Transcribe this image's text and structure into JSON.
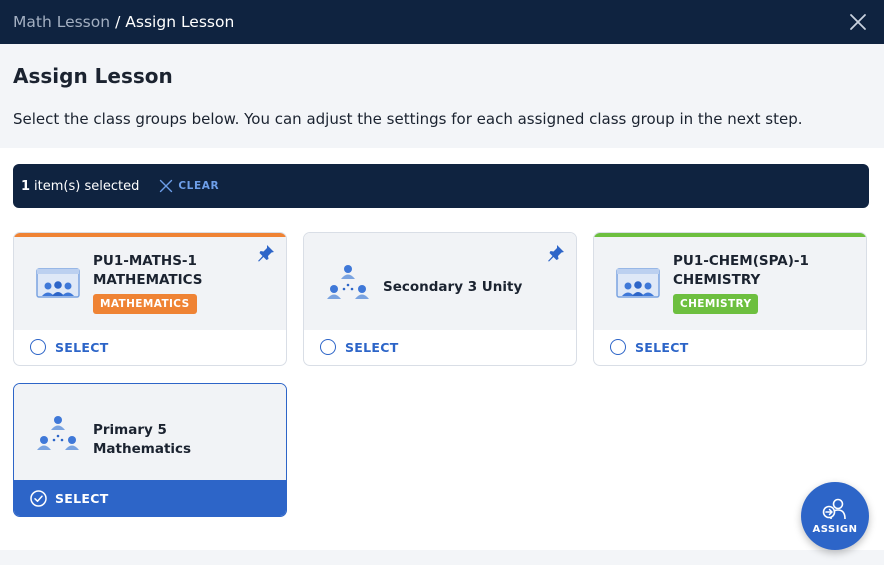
{
  "breadcrumb": {
    "parent": "Math Lesson",
    "separator": "/",
    "current": "Assign Lesson"
  },
  "header": {
    "title": "Assign Lesson",
    "description": "Select the class groups below. You can adjust the settings for each assigned class group in the next step."
  },
  "selection_bar": {
    "count": "1",
    "count_label": "item(s) selected",
    "clear_label": "CLEAR"
  },
  "cards": [
    {
      "code": "PU1-MATHS-1",
      "name": "MATHEMATICS",
      "tag": "MATHEMATICS",
      "tag_color": "#ef8334",
      "accent_color": "#ef8334",
      "icon": "classroom-icon",
      "pinned": true,
      "selected": false,
      "select_label": "SELECT"
    },
    {
      "name": "Secondary 3 Unity",
      "icon": "group-icon",
      "pinned": true,
      "selected": false,
      "select_label": "SELECT"
    },
    {
      "code": "PU1-CHEM(SPA)-1",
      "name": "CHEMISTRY",
      "tag": "CHEMISTRY",
      "tag_color": "#6dbf3f",
      "accent_color": "#6dbf3f",
      "icon": "classroom-icon",
      "pinned": false,
      "selected": false,
      "select_label": "SELECT"
    },
    {
      "name_line1": "Primary 5",
      "name_line2": "Mathematics",
      "icon": "group-icon",
      "pinned": false,
      "selected": true,
      "select_label": "SELECT"
    }
  ],
  "assign_button": {
    "label": "ASSIGN",
    "icon": "assign-user-icon"
  },
  "colors": {
    "navy": "#0f2340",
    "primary": "#2d65c8",
    "link": "#6d9ee8"
  }
}
